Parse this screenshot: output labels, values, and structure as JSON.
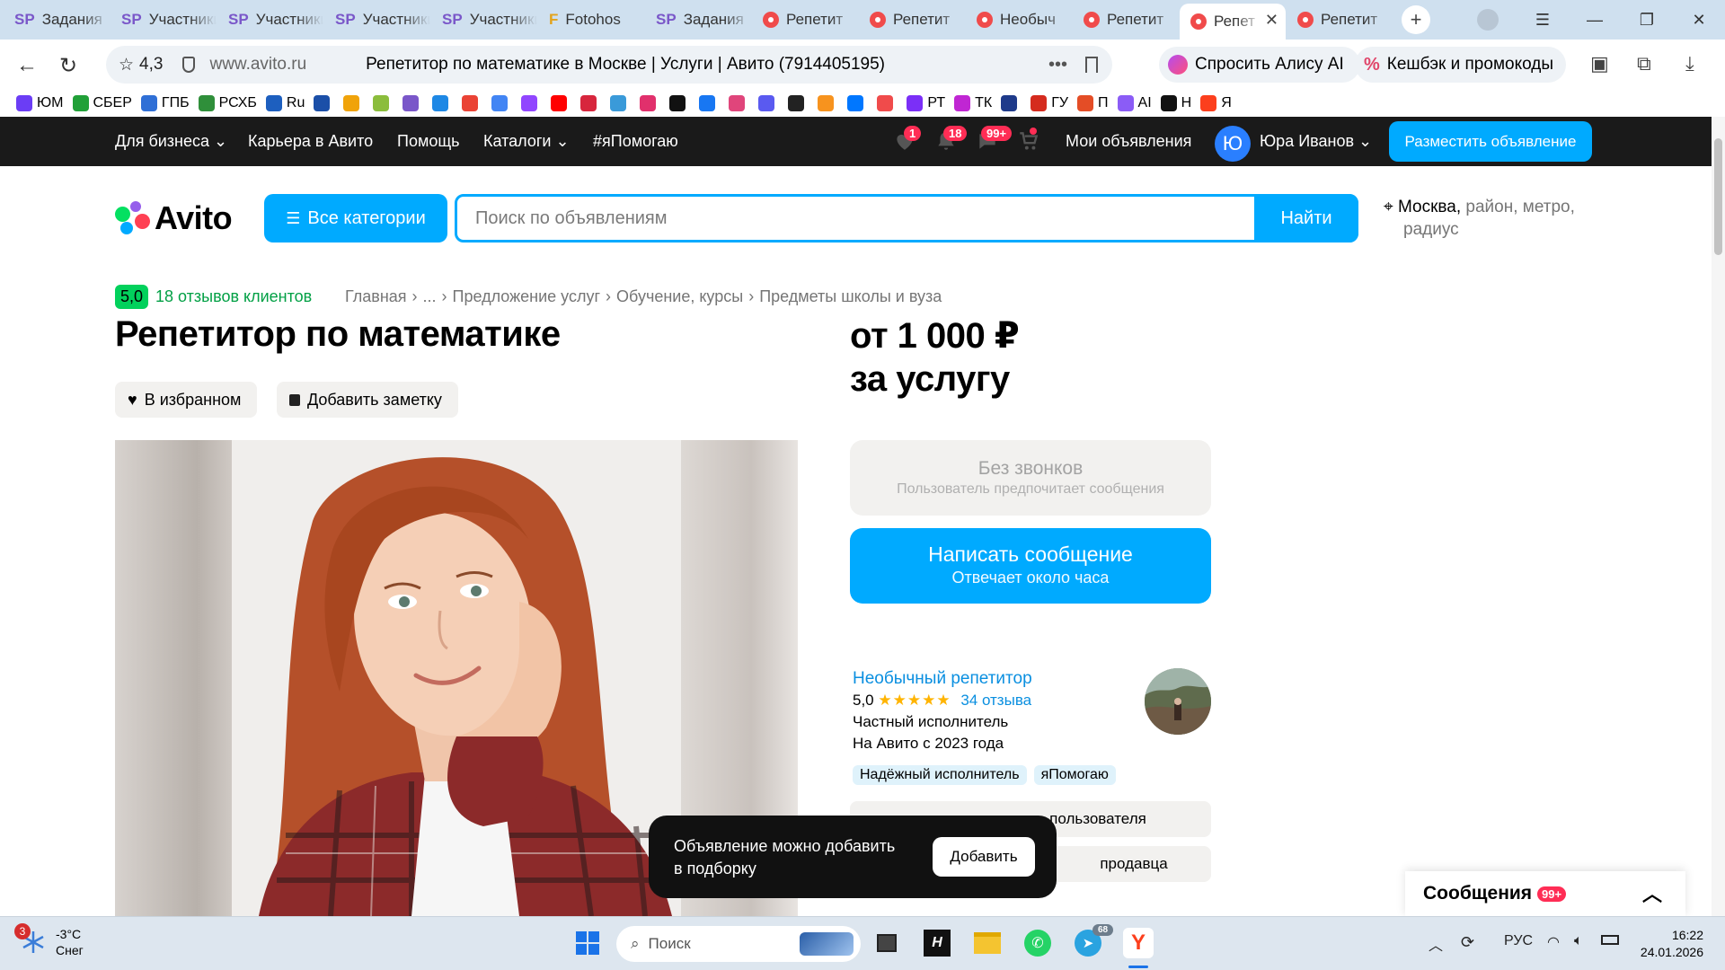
{
  "browser": {
    "tabs": [
      {
        "icon": "sp",
        "label": "Задания"
      },
      {
        "icon": "sp",
        "label": "Участники"
      },
      {
        "icon": "sp",
        "label": "Участники"
      },
      {
        "icon": "sp",
        "label": "Участники"
      },
      {
        "icon": "sp",
        "label": "Участники"
      },
      {
        "icon": "ft",
        "label": "Fotohos"
      },
      {
        "icon": "sp",
        "label": "Задания"
      },
      {
        "icon": "av",
        "label": "Репетит"
      },
      {
        "icon": "av",
        "label": "Репетит"
      },
      {
        "icon": "av",
        "label": "Необыч"
      },
      {
        "icon": "av",
        "label": "Репетит"
      },
      {
        "icon": "av",
        "label": "Репет",
        "active": true
      },
      {
        "icon": "av",
        "label": "Репетит"
      }
    ],
    "site_rating": "4,3",
    "domain": "www.avito.ru",
    "page_title": "Репетитор по математике в Москве | Услуги | Авито (7914405195)",
    "alice_label": "Спросить Алису AI",
    "cashback_label": "Кешбэк и промокоды",
    "bookmarks": [
      {
        "label": "ЮМ",
        "color": "#6b3df5"
      },
      {
        "label": "СБЕР",
        "color": "#21a038"
      },
      {
        "label": "ГПБ",
        "color": "#2f6fd6"
      },
      {
        "label": "РСХБ",
        "color": "#2f8f3a"
      },
      {
        "label": "Ru",
        "color": "#1d5fbf"
      },
      {
        "label": "",
        "color": "#1b4fa8"
      },
      {
        "label": "",
        "color": "#f0a30a"
      },
      {
        "label": "",
        "color": "#8bbd3c"
      },
      {
        "label": "",
        "color": "#7a57c9"
      },
      {
        "label": "",
        "color": "#1e88e5"
      },
      {
        "label": "",
        "color": "#ea4335"
      },
      {
        "label": "",
        "color": "#4285f4"
      },
      {
        "label": "",
        "color": "#9146ff"
      },
      {
        "label": "",
        "color": "#ff0000"
      },
      {
        "label": "",
        "color": "#d7263d"
      },
      {
        "label": "",
        "color": "#3a9ad9"
      },
      {
        "label": "",
        "color": "#e1306c"
      },
      {
        "label": "",
        "color": "#111111"
      },
      {
        "label": "",
        "color": "#1877f2"
      },
      {
        "label": "",
        "color": "#e0457b"
      },
      {
        "label": "",
        "color": "#5a5af0"
      },
      {
        "label": "",
        "color": "#222222"
      },
      {
        "label": "",
        "color": "#f7931e"
      },
      {
        "label": "",
        "color": "#0077ff"
      },
      {
        "label": "",
        "color": "#f04b4b"
      },
      {
        "label": "РТ",
        "color": "#7b2ff7"
      },
      {
        "label": "ТК",
        "color": "#c026d3"
      },
      {
        "label": "",
        "color": "#1e3a8a"
      },
      {
        "label": "ГУ",
        "color": "#d52b1e"
      },
      {
        "label": "П",
        "color": "#e44d26"
      },
      {
        "label": "AI",
        "color": "#8b5cf6"
      },
      {
        "label": "Н",
        "color": "#111111"
      },
      {
        "label": "Я",
        "color": "#fc3f1d"
      }
    ]
  },
  "avito_header": {
    "business": "Для бизнеса",
    "career": "Карьера в Авито",
    "help": "Помощь",
    "catalogs": "Каталоги",
    "ya_help": "#яПомогаю",
    "fav_badge": "1",
    "notif_badge": "18",
    "msg_badge": "99+",
    "my_ads": "Мои объявления",
    "avatar_letter": "Ю",
    "user_name": "Юра Иванов",
    "place_ad": "Разместить объявление"
  },
  "search": {
    "logo": "Avito",
    "categories": "Все категории",
    "placeholder": "Поиск по объявлениям",
    "find": "Найти",
    "city": "Москва,",
    "area": "район, метро,",
    "radius": "радиус"
  },
  "listing": {
    "score": "5,0",
    "reviews": "18 отзывов клиентов",
    "breadcrumbs": [
      "Главная",
      "›",
      "...",
      "›",
      "Предложение услуг",
      "›",
      "Обучение, курсы",
      "›",
      "Предметы школы и вуза"
    ],
    "title": "Репетитор по математике",
    "favorite": "В избранном",
    "note": "Добавить заметку",
    "price_line1": "от 1 000 ₽",
    "price_line2": "за услугу",
    "nocall_title": "Без звонков",
    "nocall_sub": "Пользователь предпочитает сообщения",
    "write_title": "Написать сообщение",
    "write_sub": "Отвечает около часа"
  },
  "seller": {
    "name": "Необычный репетитор",
    "rating": "5,0",
    "stars": "★★★★★",
    "reviews": "34 отзыва",
    "type": "Частный исполнитель",
    "since": "На Авито с 2023 года",
    "tags": [
      "Надёжный исполнитель",
      "яПомогаю"
    ],
    "row1": "пользователя",
    "row2": "продавца"
  },
  "toast": {
    "text": "Объявление можно добавить в подборку",
    "add": "Добавить"
  },
  "messages": {
    "label": "Сообщения",
    "badge": "99+"
  },
  "taskbar": {
    "weather_badge": "3",
    "temp": "-3°C",
    "condition": "Снег",
    "search": "Поиск",
    "telegram_badge": "68",
    "lang": "РУС",
    "time": "16:22",
    "date": "24.01.2026"
  }
}
